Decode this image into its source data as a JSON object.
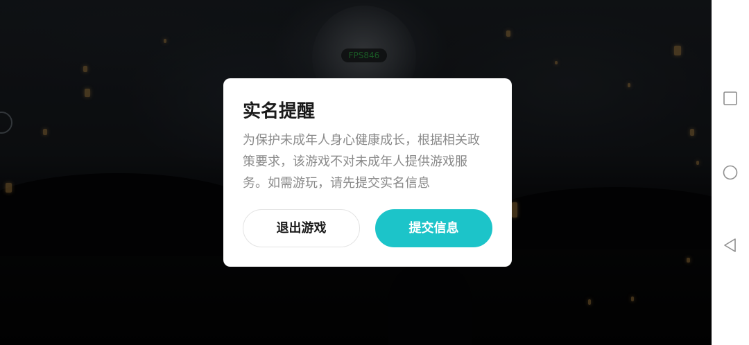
{
  "game": {
    "fps_label": "FPS846"
  },
  "dialog": {
    "title": "实名提醒",
    "message": "为保护未成年人身心健康成长，根据相关政策要求，该游戏不对未成年人提供游戏服务。如需游玩，请先提交实名信息",
    "exit_button_label": "退出游戏",
    "submit_button_label": "提交信息"
  },
  "colors": {
    "accent": "#1cc4c9",
    "fps_text": "#2ea043"
  },
  "navbar": {
    "buttons": [
      "recent-apps-icon",
      "home-icon",
      "back-icon"
    ]
  }
}
